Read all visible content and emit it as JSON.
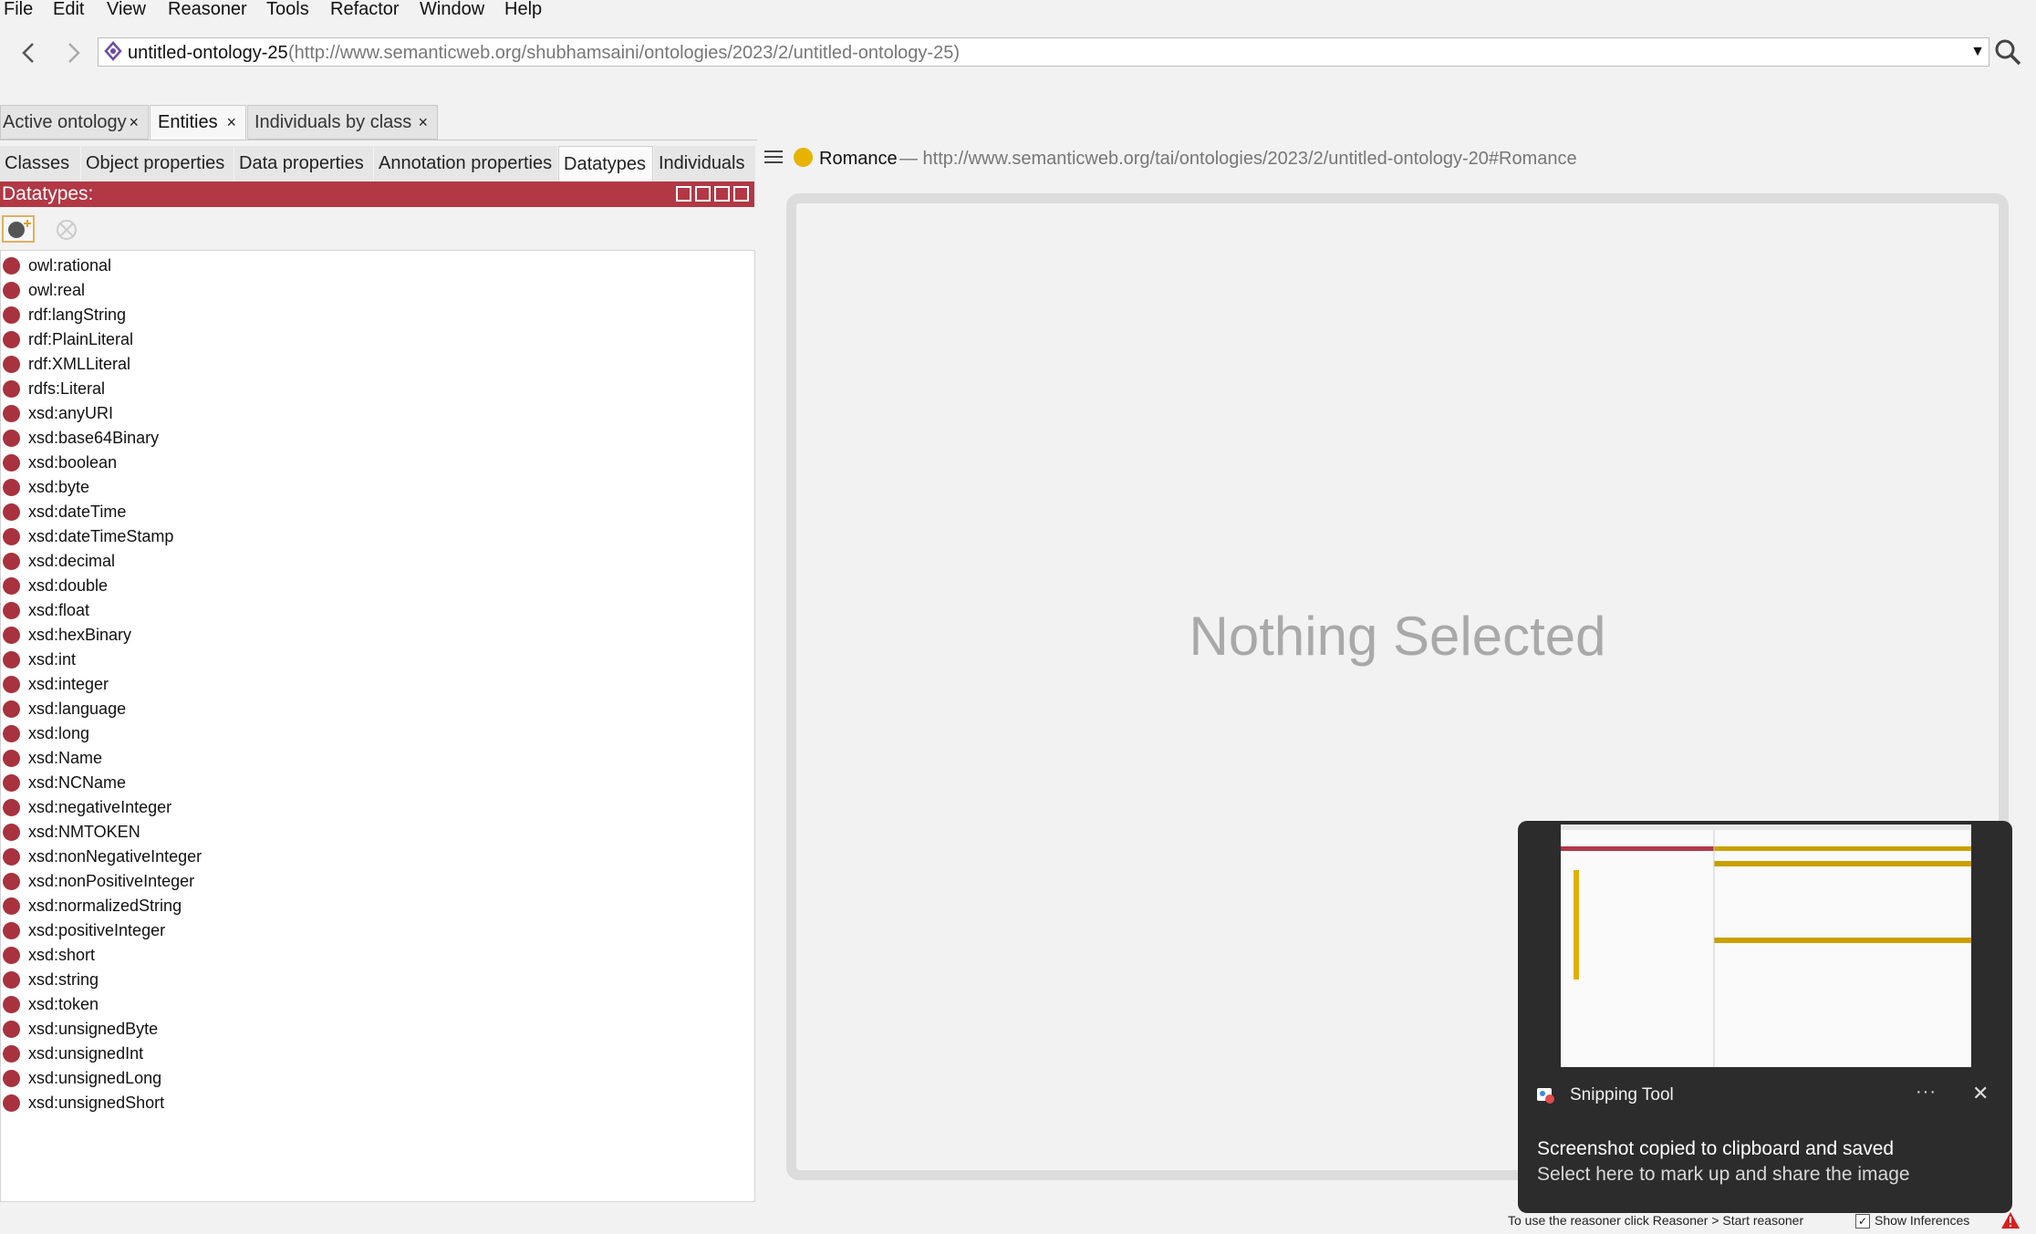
{
  "menubar": {
    "items": [
      "File",
      "Edit",
      "View",
      "Reasoner",
      "Tools",
      "Refactor",
      "Window",
      "Help"
    ]
  },
  "nav": {
    "back_icon": "arrow-left-icon",
    "forward_icon": "arrow-right-icon",
    "ontology_name": "untitled-ontology-25",
    "ontology_iri": "(http://www.semanticweb.org/shubhamsaini/ontologies/2023/2/untitled-ontology-25)",
    "search_icon": "search-icon"
  },
  "top_tabs": [
    {
      "label": "Active ontology",
      "close": "×"
    },
    {
      "label": "Entities",
      "close": "×"
    },
    {
      "label": "Individuals by class",
      "close": "×"
    }
  ],
  "entity_tabs": [
    "Classes",
    "Object properties",
    "Data properties",
    "Annotation properties",
    "Datatypes",
    "Individuals"
  ],
  "datatypes_panel": {
    "title": "Datatypes:",
    "items": [
      "owl:rational",
      "owl:real",
      "rdf:langString",
      "rdf:PlainLiteral",
      "rdf:XMLLiteral",
      "rdfs:Literal",
      "xsd:anyURI",
      "xsd:base64Binary",
      "xsd:boolean",
      "xsd:byte",
      "xsd:dateTime",
      "xsd:dateTimeStamp",
      "xsd:decimal",
      "xsd:double",
      "xsd:float",
      "xsd:hexBinary",
      "xsd:int",
      "xsd:integer",
      "xsd:language",
      "xsd:long",
      "xsd:Name",
      "xsd:NCName",
      "xsd:negativeInteger",
      "xsd:NMTOKEN",
      "xsd:nonNegativeInteger",
      "xsd:nonPositiveInteger",
      "xsd:normalizedString",
      "xsd:positiveInteger",
      "xsd:short",
      "xsd:string",
      "xsd:token",
      "xsd:unsignedByte",
      "xsd:unsignedInt",
      "xsd:unsignedLong",
      "xsd:unsignedShort"
    ],
    "item_color": "#a8323e",
    "header_color": "#b23845"
  },
  "selection": {
    "name": "Romance",
    "iri": "— http://www.semanticweb.org/tai/ontologies/2023/2/untitled-ontology-20#Romance",
    "dot_color": "#e6b400"
  },
  "detail": {
    "empty_text": "Nothing Selected"
  },
  "toast": {
    "app_name": "Snipping Tool",
    "more": "···",
    "close": "✕",
    "title": "Screenshot copied to clipboard and saved",
    "body": "Select here to mark up and share the image"
  },
  "status": {
    "reasoner_hint": "To use the reasoner click Reasoner > Start reasoner",
    "show_inferences_checked": true,
    "show_inferences_label": "Show Inferences"
  }
}
